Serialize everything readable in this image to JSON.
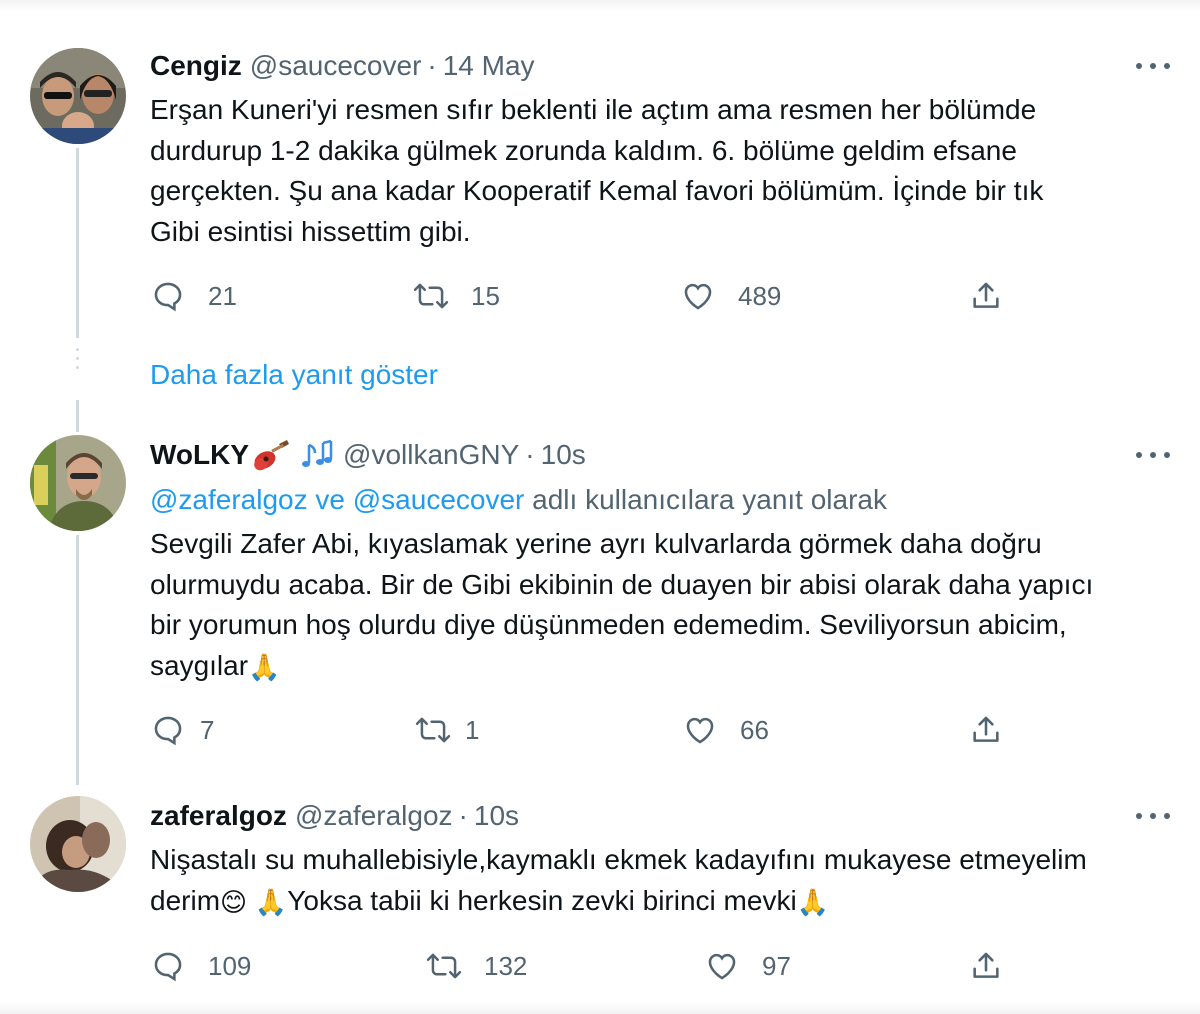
{
  "tweets": [
    {
      "display_name": "Cengiz",
      "handle": "@saucecover",
      "separator": "·",
      "timestamp": "14 May",
      "text_lines": [
        "Erşan Kuneri'yi resmen sıfır beklenti ile açtım ama resmen her bölümde",
        "durdurup 1-2 dakika gülmek zorunda kaldım. 6. bölüme geldim efsane",
        "gerçekten. Şu ana kadar Kooperatif Kemal favori bölümüm. İçinde bir tık",
        "Gibi esintisi hissettim gibi."
      ],
      "replies": "21",
      "retweets": "15",
      "likes": "489"
    },
    {
      "display_name": "WoLKY",
      "display_name_emojis": [
        "guitar-emoji",
        "musical-notes-emoji"
      ],
      "handle": "@vollkanGNY",
      "separator": "·",
      "timestamp": "10s",
      "reply_context": {
        "mention_1": "@zaferalgoz",
        "joiner": " ve ",
        "mention_2": "@saucecover",
        "suffix": " adlı kullanıcılara yanıt olarak"
      },
      "text_lines": [
        "Sevgili Zafer Abi, kıyaslamak yerine ayrı kulvarlarda görmek daha doğru",
        "olurmuydu acaba. Bir de Gibi ekibinin de duayen bir abisi olarak daha yapıcı",
        "bir yorumun hoş olurdu diye düşünmeden edemedim. Seviliyorsun abicim,",
        "saygılar"
      ],
      "trailing_emoji": "🙏",
      "replies": "7",
      "retweets": "1",
      "likes": "66"
    },
    {
      "display_name": "zaferalgoz",
      "handle": "@zaferalgoz",
      "separator": "·",
      "timestamp": "10s",
      "text_line_1": "Nişastalı su muhallebisiyle,kaymaklı ekmek kadayıfını mukayese etmeyelim",
      "text_line_2_a": "derim",
      "emoji_smile": "😊",
      "emoji_pray_1": "🙏",
      "text_line_2_b": "Yoksa tabii ki herkesin zevki birinci mevki",
      "emoji_pray_2": "🙏",
      "replies": "109",
      "retweets": "132",
      "likes": "97"
    }
  ],
  "show_more_replies": "Daha fazla yanıt göster",
  "colors": {
    "text": "#0f1419",
    "secondary": "#536471",
    "link": "#1d9bf0",
    "thread_line": "#cfd9de"
  },
  "icons": [
    "reply-icon",
    "retweet-icon",
    "like-icon",
    "share-icon",
    "more-icon"
  ]
}
